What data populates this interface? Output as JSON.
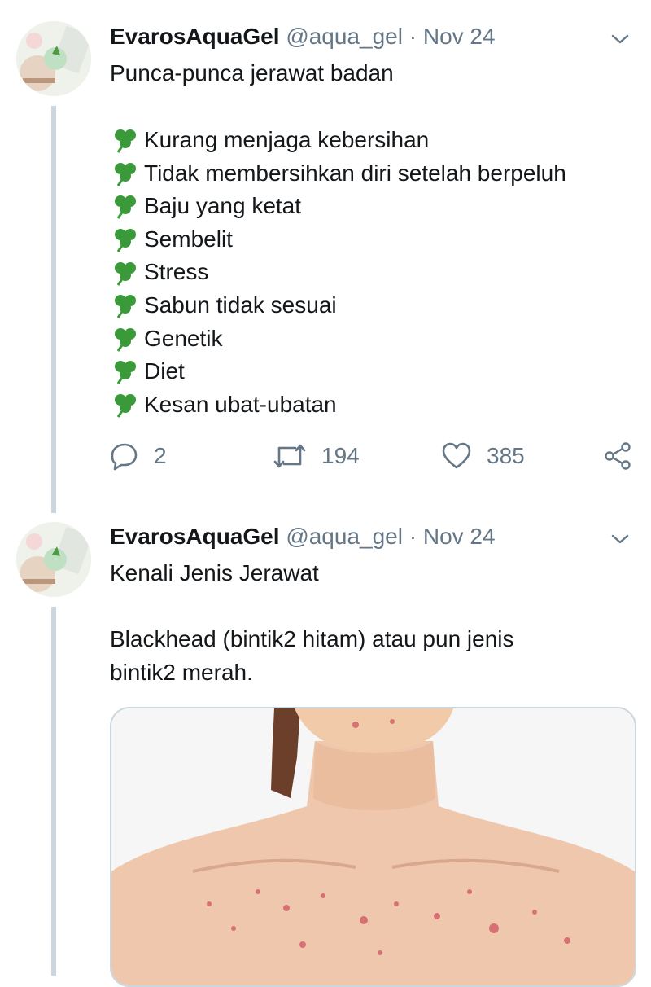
{
  "tweets": [
    {
      "author_name": "EvarosAquaGel",
      "handle": "@aqua_gel",
      "separator": "·",
      "date": "Nov 24",
      "text": "Punca-punca jerawat badan",
      "list_icon": "shamrock-icon",
      "list": [
        "Kurang menjaga kebersihan",
        "Tidak membersihkan diri setelah berpeluh",
        "Baju yang ketat",
        "Sembelit",
        "Stress",
        "Sabun tidak sesuai",
        "Genetik",
        "Diet",
        "Kesan ubat-ubatan"
      ],
      "actions": {
        "reply_count": "2",
        "retweet_count": "194",
        "like_count": "385"
      }
    },
    {
      "author_name": "EvarosAquaGel",
      "handle": "@aqua_gel",
      "separator": "·",
      "date": "Nov 24",
      "text_lines": [
        "Kenali Jenis Jerawat",
        "",
        "Blackhead (bintik2 hitam) atau pun jenis",
        "bintik2 merah."
      ]
    }
  ],
  "colors": {
    "text": "#14171a",
    "secondary": "#657786",
    "thread_line": "#ccd6dd",
    "shamrock": "#3a9a3a"
  }
}
